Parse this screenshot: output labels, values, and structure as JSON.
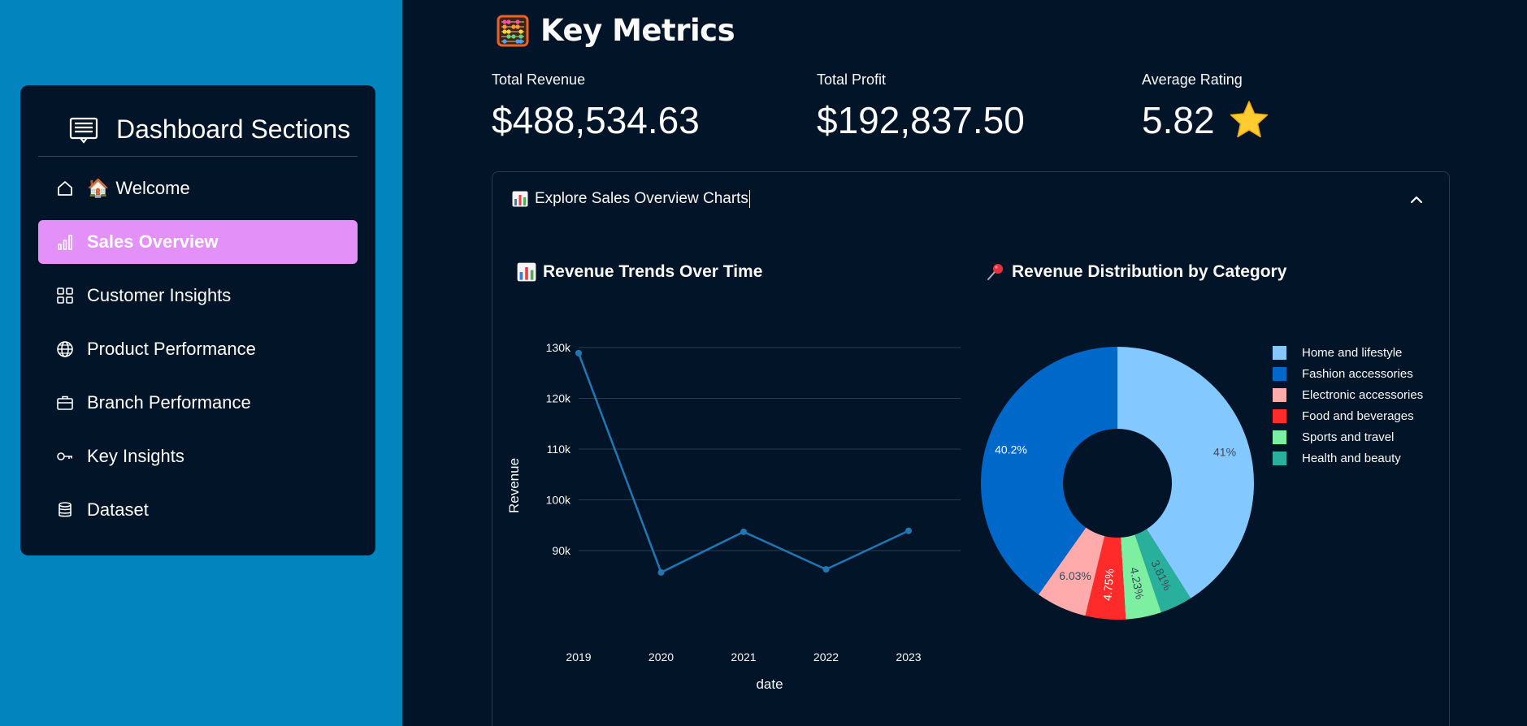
{
  "sidebar": {
    "title": "Dashboard Sections",
    "items": [
      {
        "icon": "home-icon",
        "emoji": "🏠",
        "label": "Welcome",
        "active": false
      },
      {
        "icon": "bar-chart-icon",
        "emoji": "",
        "label": "Sales Overview",
        "active": true
      },
      {
        "icon": "grid-icon",
        "emoji": "",
        "label": "Customer Insights",
        "active": false
      },
      {
        "icon": "globe-icon",
        "emoji": "",
        "label": "Product Performance",
        "active": false
      },
      {
        "icon": "briefcase-icon",
        "emoji": "",
        "label": "Branch Performance",
        "active": false
      },
      {
        "icon": "key-icon",
        "emoji": "",
        "label": "Key Insights",
        "active": false
      },
      {
        "icon": "database-icon",
        "emoji": "",
        "label": "Dataset",
        "active": false
      }
    ],
    "colors": {
      "background": "#0284be",
      "card": "#021428",
      "active": "#e390f8"
    }
  },
  "main": {
    "title": "Key Metrics",
    "metrics": [
      {
        "label": "Total Revenue",
        "value": "$488,534.63"
      },
      {
        "label": "Total Profit",
        "value": "$192,837.50"
      },
      {
        "label": "Average Rating",
        "value": "5.82"
      }
    ],
    "expander": {
      "label": "Explore Sales Overview Charts",
      "line_chart_title": "Revenue Trends Over Time",
      "pie_chart_title": "Revenue Distribution by Category"
    }
  },
  "chart_data": [
    {
      "type": "line",
      "x": [
        "2019",
        "2020",
        "2021",
        "2022",
        "2023"
      ],
      "series": [
        {
          "values": [
            128900,
            85700,
            93700,
            86300,
            93900
          ],
          "color": "#1f77b4"
        }
      ],
      "xlabel": "date",
      "ylabel": "Revenue",
      "yticks": [
        "90k",
        "100k",
        "110k",
        "120k",
        "130k"
      ],
      "ylim": [
        80000,
        130000
      ],
      "grid": true
    },
    {
      "type": "pie",
      "hole": true,
      "labels": [
        "Home and lifestyle",
        "Fashion accessories",
        "Electronic accessories",
        "Food and beverages",
        "Sports and travel",
        "Health and beauty"
      ],
      "values": [
        41,
        40.2,
        6.03,
        4.75,
        4.23,
        3.81
      ],
      "slice_order": [
        "Home and lifestyle",
        "Health and beauty",
        "Sports and travel",
        "Food and beverages",
        "Electronic accessories",
        "Fashion accessories"
      ],
      "text_labels": {
        "Home and lifestyle": "41%",
        "Fashion accessories": "40.2%",
        "Electronic accessories": "6.03%",
        "Food and beverages": "4.75%",
        "Sports and travel": "4.23%",
        "Health and beauty": "3.81%"
      },
      "colors": {
        "Home and lifestyle": "#83c9ff",
        "Fashion accessories": "#0068c9",
        "Electronic accessories": "#ffabab",
        "Food and beverages": "#ff2b2b",
        "Sports and travel": "#7defa1",
        "Health and beauty": "#29b09d"
      },
      "legend": "right"
    }
  ]
}
